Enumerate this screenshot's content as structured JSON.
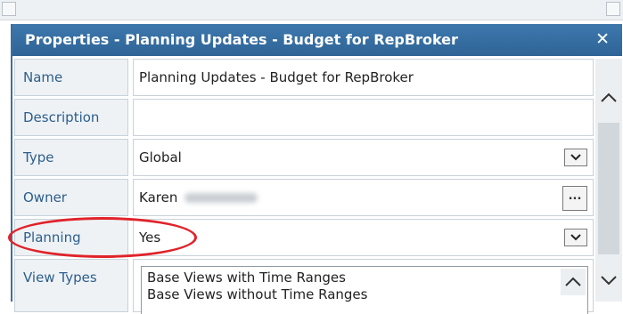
{
  "panel": {
    "title": "Properties - Planning Updates - Budget for RepBroker",
    "close_glyph": "✕"
  },
  "fields": {
    "name": {
      "label": "Name",
      "value": "Planning Updates - Budget for RepBroker"
    },
    "description": {
      "label": "Description",
      "value": ""
    },
    "type": {
      "label": "Type",
      "value": "Global"
    },
    "owner": {
      "label": "Owner",
      "value": "Karen",
      "button_label": "..."
    },
    "planning": {
      "label": "Planning",
      "value": "Yes"
    },
    "view_types": {
      "label": "View Types",
      "options": [
        "Base Views with Time Ranges",
        "Base Views without Time Ranges"
      ]
    }
  },
  "icons": {
    "close": "close-icon",
    "dropdown": "chevron-down-icon",
    "scroll_up": "chevron-up-icon",
    "scroll_down": "chevron-down-icon"
  },
  "colors": {
    "titlebar": "#3d78ad",
    "label_text": "#2d5e8c",
    "highlight": "#e0232a"
  }
}
